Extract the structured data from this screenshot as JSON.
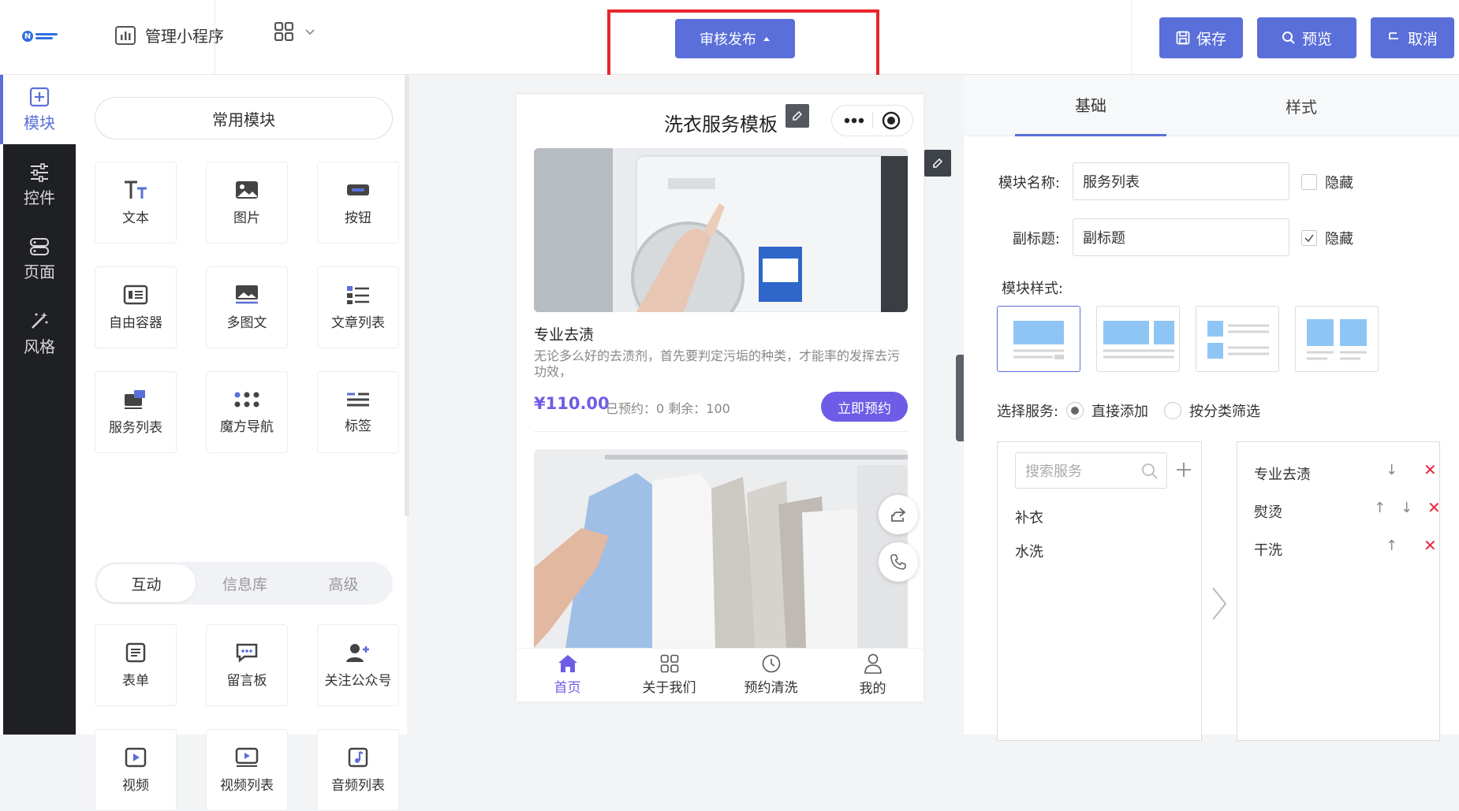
{
  "header": {
    "manage_label": "管理小程序",
    "publish_label": "审核发布",
    "save_label": "保存",
    "preview_label": "预览",
    "cancel_label": "取消"
  },
  "sidebar": {
    "items": [
      {
        "label": "模块",
        "icon": "plus-square-icon",
        "active": true
      },
      {
        "label": "控件",
        "icon": "sliders-icon",
        "active": false
      },
      {
        "label": "页面",
        "icon": "pages-icon",
        "active": false
      },
      {
        "label": "风格",
        "icon": "magic-wand-icon",
        "active": false
      }
    ]
  },
  "panel": {
    "common_title": "常用模块",
    "common_modules": [
      "文本",
      "图片",
      "按钮",
      "自由容器",
      "多图文",
      "文章列表",
      "服务列表",
      "魔方导航",
      "标签"
    ],
    "segments": [
      "互动",
      "信息库",
      "高级"
    ],
    "interactive_modules": [
      "表单",
      "留言板",
      "关注公众号",
      "视频",
      "视频列表",
      "音频列表"
    ]
  },
  "phone": {
    "title": "洗衣服务模板",
    "service": {
      "name": "专业去渍",
      "desc": "无论多么好的去渍剂，首先要判定污垢的种类，才能率的发挥去污功效，",
      "price": "¥110.00",
      "meta": "已预约：0 剩余：100",
      "book_label": "立即预约"
    },
    "tabs": [
      "首页",
      "关于我们",
      "预约清洗",
      "我的"
    ]
  },
  "settings": {
    "tabs": [
      "基础",
      "样式"
    ],
    "module_name_label": "模块名称:",
    "module_name_value": "服务列表",
    "subtitle_label": "副标题:",
    "subtitle_value": "副标题",
    "hide_label": "隐藏",
    "style_label": "模块样式:",
    "select_service_label": "选择服务:",
    "radio_direct": "直接添加",
    "radio_category": "按分类筛选",
    "search_placeholder": "搜索服务",
    "available": [
      "补衣",
      "水洗"
    ],
    "selected": [
      "专业去渍",
      "熨烫",
      "干洗"
    ]
  },
  "colors": {
    "accent": "#5a6fd9",
    "brand_purple": "#6f5ce6",
    "highlight_red": "#e8262c"
  }
}
